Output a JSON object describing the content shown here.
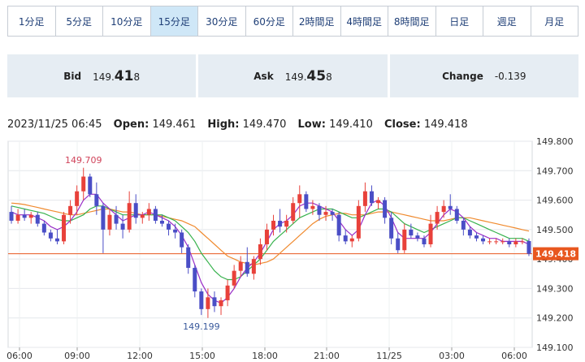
{
  "tabs": [
    "1分足",
    "5分足",
    "10分足",
    "15分足",
    "30分足",
    "60分足",
    "2時間足",
    "4時間足",
    "8時間足",
    "日足",
    "週足",
    "月足"
  ],
  "active_tab": "15分足",
  "quotes": {
    "bid_label": "Bid",
    "bid_main": "149.",
    "bid_big": "41",
    "bid_small": "8",
    "ask_label": "Ask",
    "ask_main": "149.",
    "ask_big": "45",
    "ask_small": "8",
    "change_label": "Change",
    "change_value": "-0.139"
  },
  "ohlc": {
    "datetime": "2023/11/25 06:45",
    "open_label": "Open:",
    "open": "149.461",
    "high_label": "High:",
    "high": "149.470",
    "low_label": "Low:",
    "low": "149.410",
    "close_label": "Close:",
    "close": "149.418"
  },
  "colors": {
    "up": "#e8413a",
    "down": "#4a4ec6",
    "ma_purple": "#9a2ec8",
    "ma_green": "#37b24d",
    "ma_orange": "#f08a2e",
    "price_tag": "#e8571f"
  },
  "chart_data": {
    "type": "candlestick",
    "ylim": [
      149.1,
      149.8
    ],
    "yticks": [
      "149.800",
      "149.700",
      "149.600",
      "149.500",
      "149.400",
      "149.300",
      "149.200",
      "149.100"
    ],
    "xtick_labels": [
      "06:00",
      "09:00",
      "12:00",
      "15:00",
      "18:00",
      "21:00",
      "11/25",
      "03:00",
      "06:00"
    ],
    "current_price_label": "149.418",
    "high_annotation": "149.709",
    "low_annotation": "149.199",
    "candles": [
      [
        149.56,
        149.58,
        149.52,
        149.53
      ],
      [
        149.53,
        149.57,
        149.52,
        149.55
      ],
      [
        149.55,
        149.57,
        149.53,
        149.54
      ],
      [
        149.54,
        149.56,
        149.52,
        149.55
      ],
      [
        149.55,
        149.56,
        149.51,
        149.52
      ],
      [
        149.52,
        149.53,
        149.48,
        149.49
      ],
      [
        149.49,
        149.5,
        149.46,
        149.47
      ],
      [
        149.47,
        149.5,
        149.45,
        149.46
      ],
      [
        149.46,
        149.56,
        149.45,
        149.55
      ],
      [
        149.55,
        149.6,
        149.52,
        149.58
      ],
      [
        149.58,
        149.65,
        149.55,
        149.63
      ],
      [
        149.63,
        149.71,
        149.6,
        149.68
      ],
      [
        149.68,
        149.69,
        149.61,
        149.62
      ],
      [
        149.62,
        149.66,
        149.55,
        149.58
      ],
      [
        149.58,
        149.59,
        149.42,
        149.5
      ],
      [
        149.5,
        149.57,
        149.48,
        149.55
      ],
      [
        149.55,
        149.58,
        149.5,
        149.52
      ],
      [
        149.52,
        149.55,
        149.47,
        149.5
      ],
      [
        149.5,
        149.63,
        149.49,
        149.59
      ],
      [
        149.59,
        149.62,
        149.52,
        149.54
      ],
      [
        149.54,
        149.56,
        149.52,
        149.55
      ],
      [
        149.55,
        149.59,
        149.53,
        149.57
      ],
      [
        149.57,
        149.58,
        149.52,
        149.53
      ],
      [
        149.53,
        149.55,
        149.51,
        149.52
      ],
      [
        149.52,
        149.53,
        149.48,
        149.5
      ],
      [
        149.5,
        149.52,
        149.47,
        149.49
      ],
      [
        149.49,
        149.5,
        149.42,
        149.44
      ],
      [
        149.44,
        149.45,
        149.35,
        149.37
      ],
      [
        149.37,
        149.38,
        149.27,
        149.29
      ],
      [
        149.29,
        149.3,
        149.21,
        149.23
      ],
      [
        149.23,
        149.3,
        149.2,
        149.27
      ],
      [
        149.27,
        149.29,
        149.22,
        149.24
      ],
      [
        149.24,
        149.27,
        149.21,
        149.26
      ],
      [
        149.26,
        149.33,
        149.24,
        149.31
      ],
      [
        149.31,
        149.38,
        149.3,
        149.36
      ],
      [
        149.36,
        149.41,
        149.34,
        149.39
      ],
      [
        149.39,
        149.44,
        149.34,
        149.35
      ],
      [
        149.35,
        149.41,
        149.33,
        149.4
      ],
      [
        149.4,
        149.47,
        149.38,
        149.45
      ],
      [
        149.45,
        149.52,
        149.43,
        149.5
      ],
      [
        149.5,
        149.55,
        149.48,
        149.53
      ],
      [
        149.53,
        149.57,
        149.49,
        149.51
      ],
      [
        149.51,
        149.55,
        149.49,
        149.53
      ],
      [
        149.53,
        149.61,
        149.52,
        149.59
      ],
      [
        149.59,
        149.65,
        149.54,
        149.62
      ],
      [
        149.62,
        149.63,
        149.56,
        149.57
      ],
      [
        149.57,
        149.6,
        149.55,
        149.58
      ],
      [
        149.58,
        149.59,
        149.53,
        149.55
      ],
      [
        149.55,
        149.58,
        149.53,
        149.56
      ],
      [
        149.56,
        149.57,
        149.53,
        149.55
      ],
      [
        149.55,
        149.56,
        149.46,
        149.48
      ],
      [
        149.48,
        149.5,
        149.45,
        149.46
      ],
      [
        149.46,
        149.48,
        149.44,
        149.47
      ],
      [
        149.47,
        149.6,
        149.46,
        149.58
      ],
      [
        149.58,
        149.66,
        149.56,
        149.63
      ],
      [
        149.63,
        149.65,
        149.58,
        149.59
      ],
      [
        149.59,
        149.61,
        149.57,
        149.6
      ],
      [
        149.6,
        149.61,
        149.52,
        149.54
      ],
      [
        149.54,
        149.56,
        149.45,
        149.47
      ],
      [
        149.47,
        149.49,
        149.42,
        149.43
      ],
      [
        149.43,
        149.52,
        149.42,
        149.5
      ],
      [
        149.5,
        149.52,
        149.47,
        149.48
      ],
      [
        149.48,
        149.49,
        149.46,
        149.47
      ],
      [
        149.47,
        149.48,
        149.44,
        149.45
      ],
      [
        149.45,
        149.55,
        149.44,
        149.52
      ],
      [
        149.52,
        149.58,
        149.5,
        149.56
      ],
      [
        149.56,
        149.6,
        149.54,
        149.58
      ],
      [
        149.58,
        149.62,
        149.55,
        149.57
      ],
      [
        149.57,
        149.58,
        149.52,
        149.53
      ],
      [
        149.53,
        149.54,
        149.48,
        149.5
      ],
      [
        149.5,
        149.51,
        149.47,
        149.48
      ],
      [
        149.48,
        149.49,
        149.46,
        149.47
      ],
      [
        149.47,
        149.48,
        149.45,
        149.46
      ],
      [
        149.46,
        149.47,
        149.45,
        149.46
      ],
      [
        149.46,
        149.47,
        149.45,
        149.46
      ],
      [
        149.46,
        149.47,
        149.45,
        149.46
      ],
      [
        149.46,
        149.47,
        149.44,
        149.45
      ],
      [
        149.45,
        149.47,
        149.44,
        149.46
      ],
      [
        149.46,
        149.47,
        149.45,
        149.46
      ],
      [
        149.461,
        149.47,
        149.41,
        149.418
      ]
    ],
    "ma_purple": [
      149.56,
      149.55,
      149.55,
      149.55,
      149.54,
      149.53,
      149.51,
      149.5,
      149.51,
      149.53,
      149.56,
      149.6,
      149.62,
      149.62,
      149.59,
      149.57,
      149.55,
      149.53,
      149.54,
      149.55,
      149.55,
      149.56,
      149.55,
      149.54,
      149.53,
      149.51,
      149.48,
      149.44,
      149.38,
      149.32,
      149.28,
      149.26,
      149.25,
      149.27,
      149.3,
      149.34,
      149.37,
      149.39,
      149.42,
      149.46,
      149.5,
      149.52,
      149.53,
      149.55,
      149.58,
      149.59,
      149.59,
      149.58,
      149.57,
      149.56,
      149.53,
      149.5,
      149.48,
      149.5,
      149.55,
      149.59,
      149.6,
      149.58,
      149.54,
      149.49,
      149.47,
      149.47,
      149.47,
      149.47,
      149.49,
      149.52,
      149.55,
      149.57,
      149.56,
      149.54,
      149.51,
      149.49,
      149.48,
      149.47,
      149.47,
      149.46,
      149.46,
      149.46,
      149.46,
      149.45
    ],
    "ma_green": [
      149.58,
      149.575,
      149.57,
      149.565,
      149.56,
      149.555,
      149.545,
      149.535,
      149.53,
      149.53,
      149.54,
      149.55,
      149.57,
      149.58,
      149.58,
      149.57,
      149.56,
      149.55,
      149.55,
      149.55,
      149.55,
      149.55,
      149.55,
      149.55,
      149.54,
      149.53,
      149.51,
      149.49,
      149.46,
      149.42,
      149.39,
      149.36,
      149.34,
      149.33,
      149.33,
      149.34,
      149.36,
      149.38,
      149.4,
      149.43,
      149.46,
      149.48,
      149.5,
      149.52,
      149.54,
      149.55,
      149.56,
      149.57,
      149.57,
      149.57,
      149.56,
      149.55,
      149.54,
      149.54,
      149.55,
      149.56,
      149.57,
      149.57,
      149.56,
      149.54,
      149.52,
      149.51,
      149.5,
      149.49,
      149.5,
      149.51,
      149.52,
      149.53,
      149.54,
      149.54,
      149.53,
      149.52,
      149.51,
      149.5,
      149.49,
      149.48,
      149.47,
      149.47,
      149.47,
      149.46
    ],
    "ma_orange": [
      149.59,
      149.588,
      149.585,
      149.58,
      149.575,
      149.57,
      149.565,
      149.56,
      149.555,
      149.55,
      149.55,
      149.555,
      149.56,
      149.565,
      149.57,
      149.57,
      149.565,
      149.56,
      149.56,
      149.555,
      149.55,
      149.55,
      149.55,
      149.545,
      149.54,
      149.535,
      149.53,
      149.52,
      149.51,
      149.49,
      149.47,
      149.45,
      149.43,
      149.41,
      149.4,
      149.39,
      149.385,
      149.38,
      149.385,
      149.39,
      149.4,
      149.42,
      149.44,
      149.46,
      149.48,
      149.5,
      149.52,
      149.535,
      149.545,
      149.55,
      149.555,
      149.555,
      149.55,
      149.55,
      149.55,
      149.555,
      149.56,
      149.56,
      149.56,
      149.555,
      149.55,
      149.545,
      149.54,
      149.535,
      149.53,
      149.53,
      149.53,
      149.535,
      149.54,
      149.54,
      149.54,
      149.535,
      149.53,
      149.525,
      149.52,
      149.515,
      149.51,
      149.505,
      149.5,
      149.495
    ]
  }
}
